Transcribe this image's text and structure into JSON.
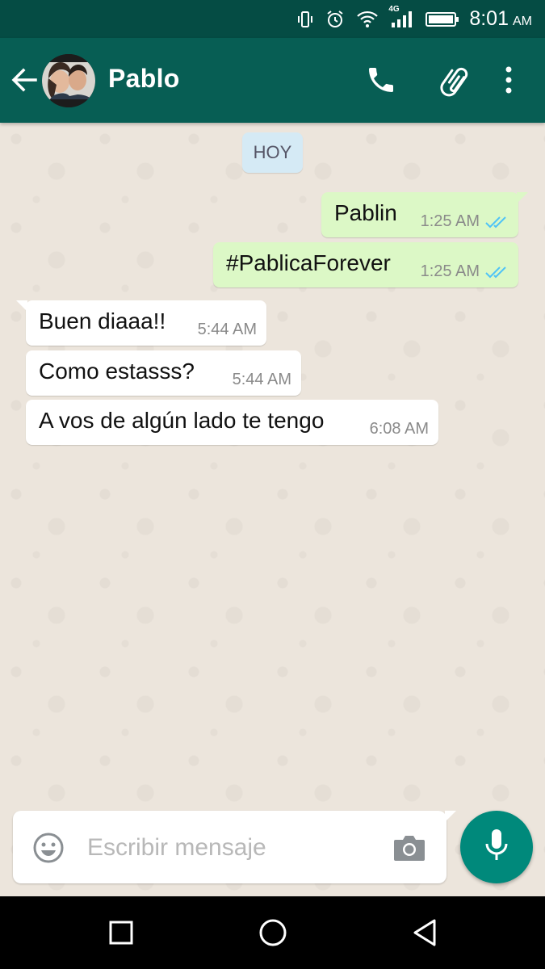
{
  "status_bar": {
    "time": "8:01",
    "ampm": "AM",
    "network": "4G",
    "icons": [
      "vibrate-icon",
      "alarm-icon",
      "wifi-icon",
      "signal-icon",
      "battery-icon"
    ]
  },
  "header": {
    "contact_name": "Pablo",
    "icons": [
      "back-arrow-icon",
      "phone-icon",
      "paperclip-icon",
      "more-vert-icon"
    ]
  },
  "chat": {
    "date_label": "HOY",
    "messages": [
      {
        "direction": "out",
        "text": "Pablin",
        "time": "1:25 AM",
        "status": "read"
      },
      {
        "direction": "out",
        "text": "#PablicaForever",
        "time": "1:25 AM",
        "status": "read"
      },
      {
        "direction": "in",
        "text": "Buen diaaa!!",
        "time": "5:44 AM"
      },
      {
        "direction": "in",
        "text": "Como estasss?",
        "time": "5:44 AM"
      },
      {
        "direction": "in",
        "text": "A vos de algún lado te tengo",
        "time": "6:08 AM"
      }
    ]
  },
  "composer": {
    "placeholder": "Escribir mensaje",
    "value": "",
    "icons": [
      "emoji-icon",
      "camera-icon",
      "mic-icon"
    ]
  },
  "nav_bar": {
    "icons": [
      "recents-icon",
      "home-icon",
      "back-icon"
    ]
  },
  "colors": {
    "status_bar": "#054c44",
    "app_bar": "#075e54",
    "outgoing_bubble": "#dcf8c6",
    "incoming_bubble": "#ffffff",
    "read_ticks": "#4fc3f7",
    "mic_button": "#00897b",
    "chat_background": "#ece5dc"
  }
}
